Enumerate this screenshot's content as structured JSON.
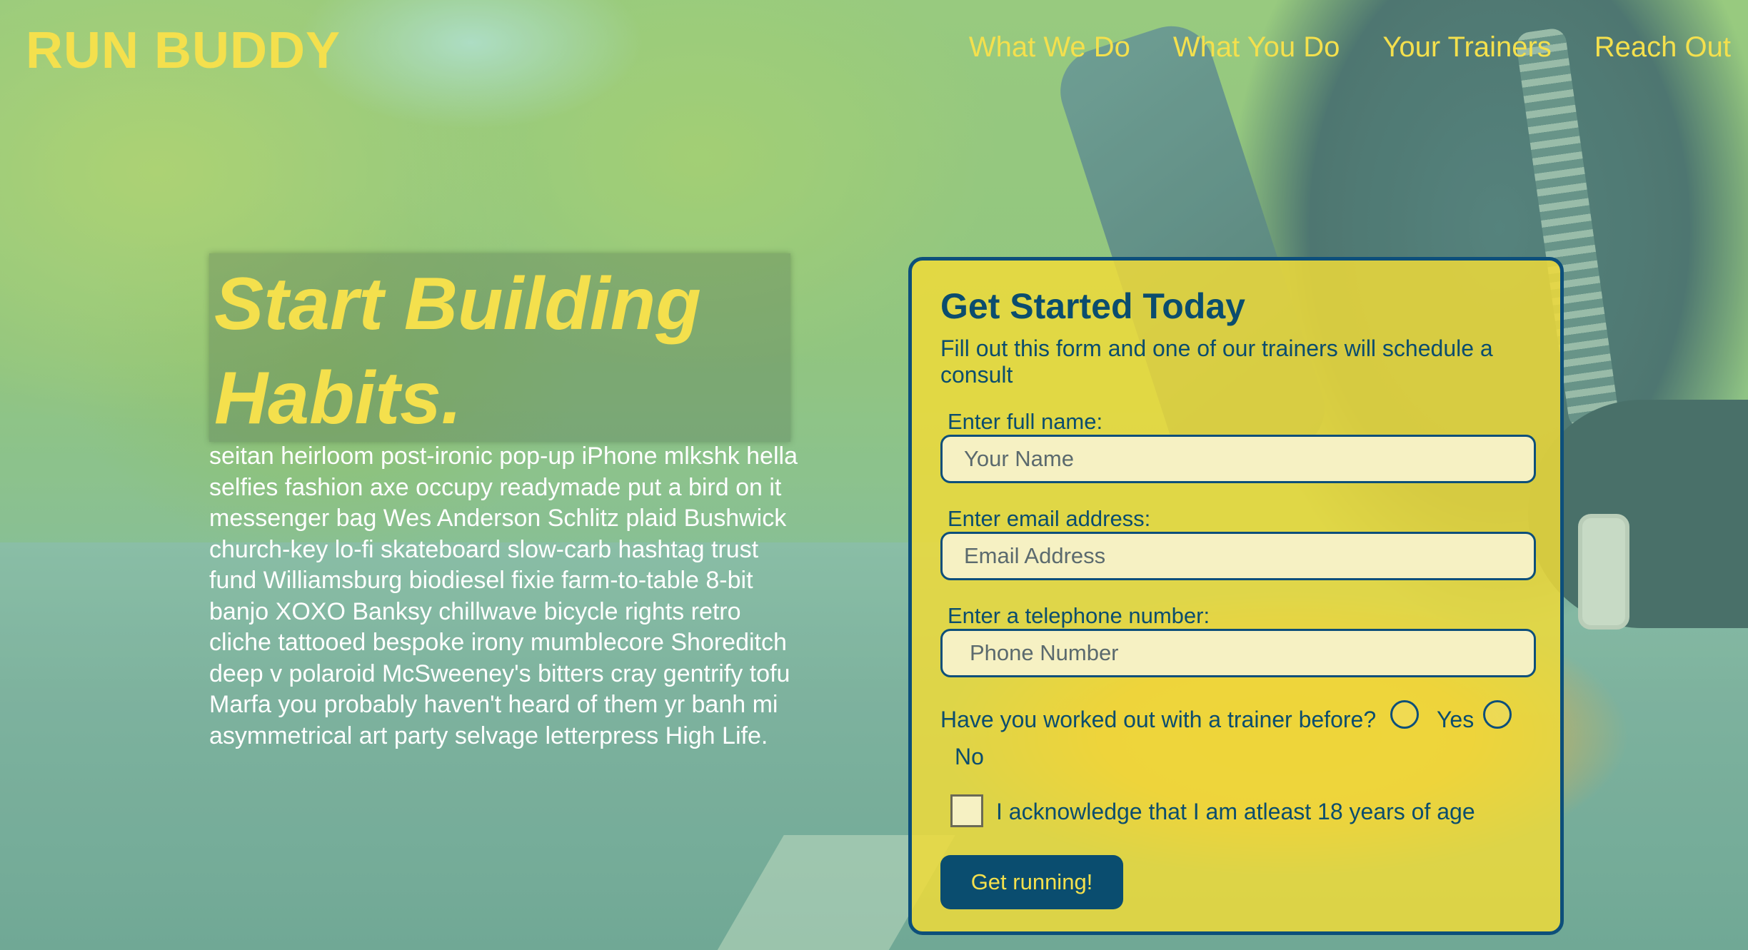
{
  "header": {
    "logo": "RUN BUDDY",
    "nav": [
      "What We Do",
      "What You Do",
      "Your Trainers",
      "Reach Out"
    ]
  },
  "hero": {
    "title_line1": "Start Building",
    "title_line2": "Habits.",
    "body": "seitan heirloom post-ironic pop-up iPhone mlkshk hella selfies fashion axe occupy readymade put a bird on it messenger bag Wes Anderson Schlitz plaid Bushwick church-key lo-fi skateboard slow-carb hashtag trust fund Williamsburg biodiesel fixie farm-to-table 8-bit banjo XOXO Banksy chillwave bicycle rights retro cliche tattooed bespoke irony mumblecore Shoreditch deep v polaroid McSweeney's bitters cray gentrify tofu Marfa you probably haven't heard of them yr banh mi asymmetrical art party selvage letterpress High Life."
  },
  "form": {
    "title": "Get Started Today",
    "subtitle": "Fill out this form and one of our trainers will schedule a consult",
    "name_label": "Enter full name:",
    "name_placeholder": "Your Name",
    "email_label": "Enter email address:",
    "email_placeholder": "Email Address",
    "phone_label": "Enter a telephone number:",
    "phone_placeholder": "Phone Number",
    "question": "Have you worked out with a trainer before?",
    "yes_label": "Yes",
    "no_label": "No",
    "acknowledge": "I acknowledge that I am atleast 18 years of age",
    "submit": "Get running!"
  },
  "colors": {
    "brand_yellow": "#f4e04d",
    "brand_navy": "#0b4d6e",
    "card_bg": "#f1db38"
  }
}
